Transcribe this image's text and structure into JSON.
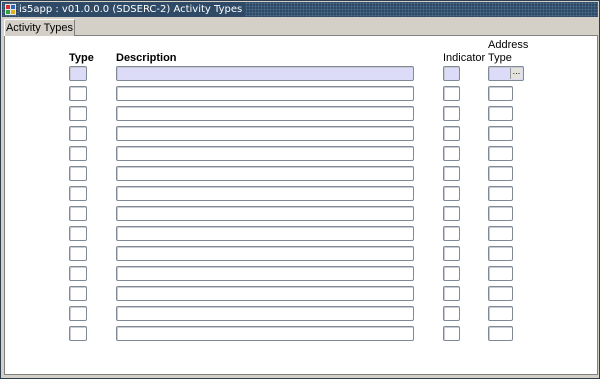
{
  "window": {
    "title": "is5app : v01.0.0.0 (SDSERC-2) Activity Types"
  },
  "tab": {
    "label": "Activity Types"
  },
  "columns": {
    "type": "Type",
    "description": "Description",
    "indicator": "Indicator",
    "address_type_line1": "Address",
    "address_type_line2": "Type"
  },
  "rows": [
    {
      "type": "",
      "description": "",
      "indicator": "",
      "address_type": ""
    },
    {
      "type": "",
      "description": "",
      "indicator": "",
      "address_type": ""
    },
    {
      "type": "",
      "description": "",
      "indicator": "",
      "address_type": ""
    },
    {
      "type": "",
      "description": "",
      "indicator": "",
      "address_type": ""
    },
    {
      "type": "",
      "description": "",
      "indicator": "",
      "address_type": ""
    },
    {
      "type": "",
      "description": "",
      "indicator": "",
      "address_type": ""
    },
    {
      "type": "",
      "description": "",
      "indicator": "",
      "address_type": ""
    },
    {
      "type": "",
      "description": "",
      "indicator": "",
      "address_type": ""
    },
    {
      "type": "",
      "description": "",
      "indicator": "",
      "address_type": ""
    },
    {
      "type": "",
      "description": "",
      "indicator": "",
      "address_type": ""
    },
    {
      "type": "",
      "description": "",
      "indicator": "",
      "address_type": ""
    },
    {
      "type": "",
      "description": "",
      "indicator": "",
      "address_type": ""
    },
    {
      "type": "",
      "description": "",
      "indicator": "",
      "address_type": ""
    },
    {
      "type": "",
      "description": "",
      "indicator": "",
      "address_type": ""
    }
  ],
  "lov_button": {
    "label": "..."
  },
  "colors": {
    "titlebar": "#2e4a66",
    "window_bg": "#d4d0c8",
    "active_field": "#dcdcf8"
  },
  "icons": {
    "app_icon": "app-icon",
    "lov": "ellipsis-icon"
  }
}
